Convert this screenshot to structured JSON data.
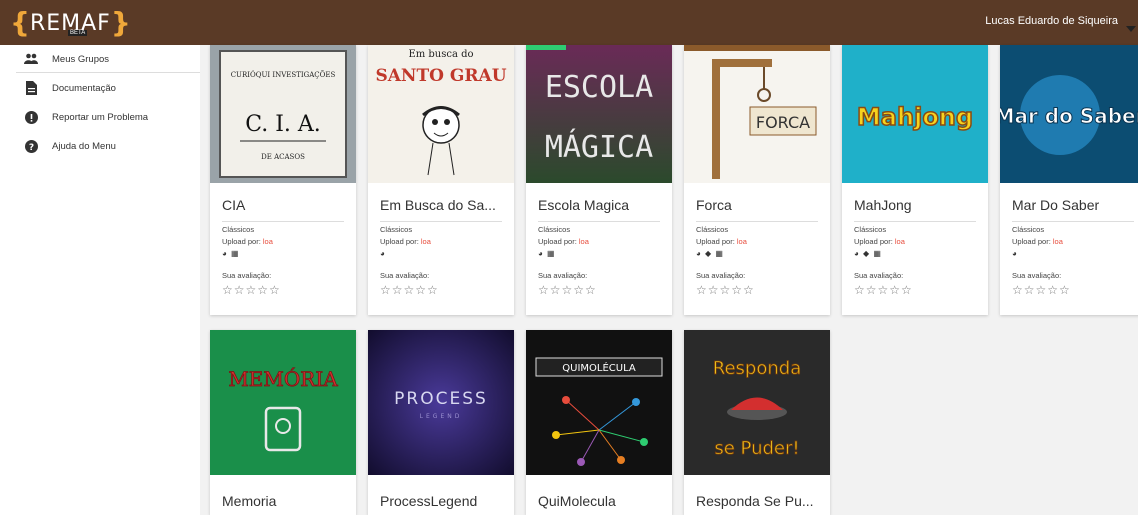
{
  "header": {
    "logo_text": "REMAF",
    "logo_badge": "BETA",
    "user_name": "Lucas Eduardo de Siqueira"
  },
  "sidebar": {
    "items": [
      {
        "label": "Meus Grupos",
        "icon": "group-icon"
      },
      {
        "label": "Documentação",
        "icon": "document-icon"
      },
      {
        "label": "Reportar um Problema",
        "icon": "alert-icon"
      },
      {
        "label": "Ajuda do Menu",
        "icon": "help-icon"
      }
    ]
  },
  "cards_labels": {
    "category": "Clássicos",
    "upload_prefix": "Upload por: ",
    "uploader": "loa",
    "rating_label": "Sua avaliação:",
    "stars": "☆☆☆☆☆"
  },
  "games": [
    {
      "title": "CIA",
      "platforms": "◕ ▦",
      "thumb_text": "C. I. A.",
      "thumb_sub": "DE ACASOS",
      "thumb_top": "CURIÓQUI INVESTIGAÇÕES"
    },
    {
      "title": "Em Busca do Sa...",
      "platforms": "◕",
      "thumb_text": "SANTO GRAU",
      "thumb_top": "Em busca do"
    },
    {
      "title": "Escola Magica",
      "platforms": "◕ ▦",
      "thumb_text": "ESCOLA",
      "thumb_sub": "MÁGICA"
    },
    {
      "title": "Forca",
      "platforms": "◕ ◆ ▦",
      "thumb_text": "FORCA"
    },
    {
      "title": "MahJong",
      "platforms": "◕ ◆ ▦",
      "thumb_text": "Mahjong"
    },
    {
      "title": "Mar Do Saber",
      "platforms": "◕",
      "thumb_text": "Mar do Saber"
    },
    {
      "title": "Memoria",
      "thumb_text": "MEMÓRIA"
    },
    {
      "title": "ProcessLegend",
      "thumb_text": "PROCESS",
      "thumb_sub": "LEGEND"
    },
    {
      "title": "QuiMolecula",
      "thumb_text": "QUIMOLÉCULA"
    },
    {
      "title": "Responda Se Pu...",
      "thumb_text": "Responda",
      "thumb_sub": "se Puder!"
    }
  ]
}
